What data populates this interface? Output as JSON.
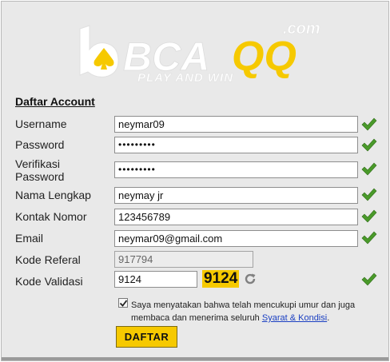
{
  "logo": {
    "brand_prefix": "BCA",
    "brand_suffix": "QQ",
    "dotcom": ".com",
    "tagline": "PLAY AND WIN",
    "color_white": "#ffffff",
    "color_yellow": "#f6c900"
  },
  "form": {
    "title": "Daftar Account",
    "fields": {
      "username": {
        "label": "Username",
        "value": "neymar09"
      },
      "password": {
        "label": "Password",
        "value": "•••••••••"
      },
      "verify_password": {
        "label_line1": "Verifikasi",
        "label_line2": "Password",
        "value": "•••••••••"
      },
      "full_name": {
        "label": "Nama Lengkap",
        "value": "neymay jr"
      },
      "contact": {
        "label": "Kontak Nomor",
        "value": "123456789"
      },
      "email": {
        "label": "Email",
        "value": "neymar09@gmail.com"
      },
      "referral": {
        "label": "Kode Referal",
        "value": "917794"
      },
      "validation": {
        "label": "Kode Validasi",
        "value": "9124",
        "captcha": "9124"
      }
    },
    "agreement": {
      "text": "Saya menyatakan bahwa telah mencukupi umur dan juga membaca dan menerima seluruh",
      "link": "Syarat & Kondisi",
      "end": ".",
      "checked": true
    },
    "submit_label": "DAFTAR"
  },
  "icons": {
    "valid": "check-icon",
    "refresh": "refresh-icon",
    "logo_mark": "spade-icon"
  },
  "colors": {
    "check": "#4a9a2a",
    "accent": "#f6c900",
    "link": "#1a3fc2"
  }
}
